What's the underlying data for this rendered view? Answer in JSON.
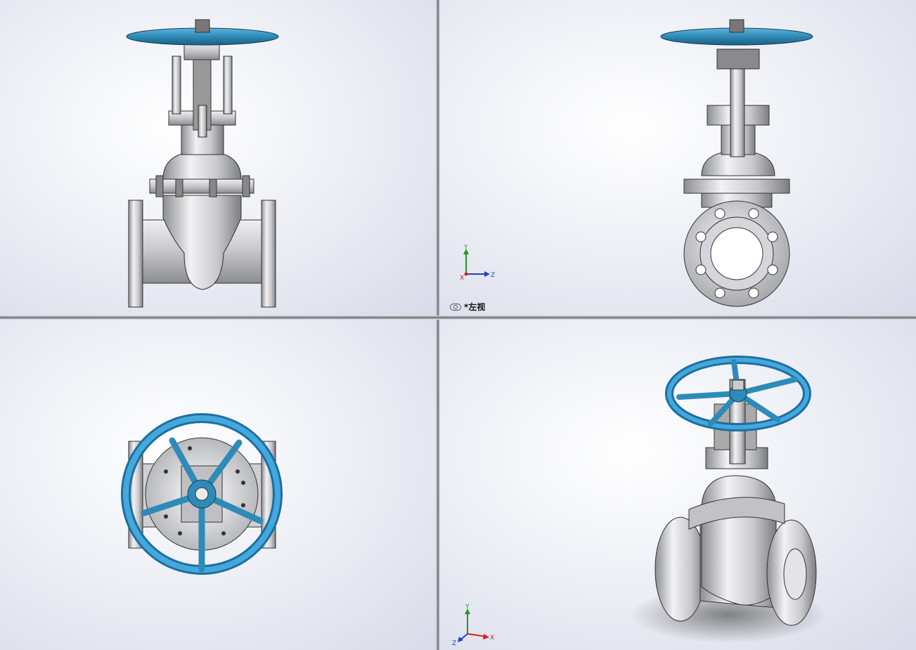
{
  "viewports": {
    "front": {
      "label": ""
    },
    "left": {
      "label": "*左视"
    },
    "top": {
      "label": ""
    },
    "iso": {
      "label": ""
    }
  },
  "triad_axes": {
    "left": {
      "up": "Y",
      "right": "Z",
      "origin": "X"
    },
    "iso": {
      "up": "Y",
      "right": "X",
      "origin": "Z"
    }
  },
  "colors": {
    "handwheel": "#2e8bb8",
    "body_metal": "#c9c9cc",
    "axis_x": "#d42020",
    "axis_y": "#1e9a1e",
    "axis_z": "#2040c8"
  },
  "icons": {
    "view_link": "link-icon"
  }
}
